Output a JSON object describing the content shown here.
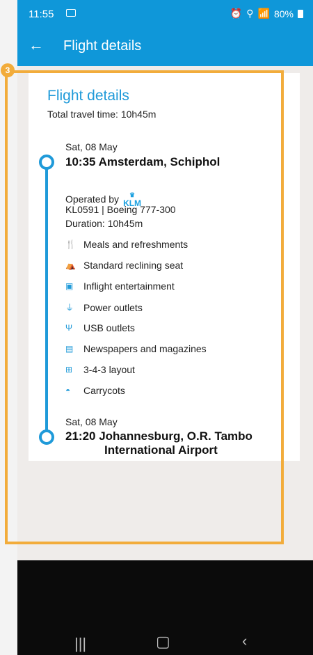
{
  "status": {
    "time": "11:55",
    "battery": "80%"
  },
  "appbar": {
    "title": "Flight details",
    "back_icon": "arrow-left-icon"
  },
  "badge": "3",
  "card": {
    "title": "Flight details",
    "total_time": "Total travel time: 10h45m",
    "departure": {
      "date": "Sat, 08 May",
      "time_place": "10:35  Amsterdam, Schiphol"
    },
    "operated_by": "Operated by",
    "airline_logo_text": "KLM",
    "flight": "KL0591 | Boeing 777-300",
    "duration": "Duration: 10h45m",
    "amenities": [
      {
        "icon": "meal-icon",
        "label": "Meals and refreshments"
      },
      {
        "icon": "seat-icon",
        "label": "Standard reclining seat"
      },
      {
        "icon": "tv-icon",
        "label": "Inflight entertainment"
      },
      {
        "icon": "plug-icon",
        "label": "Power outlets"
      },
      {
        "icon": "usb-icon",
        "label": "USB outlets"
      },
      {
        "icon": "newspaper-icon",
        "label": "Newspapers and magazines"
      },
      {
        "icon": "seat-layout-icon",
        "label": "3-4-3 layout"
      },
      {
        "icon": "carrycot-icon",
        "label": "Carrycots"
      }
    ],
    "arrival": {
      "date": "Sat, 08 May",
      "time_place_line1": "21:20  Johannesburg, O.R. Tambo",
      "time_place_line2": "International Airport"
    }
  },
  "colors": {
    "primary": "#0f97d9",
    "accent": "#f2ac3b"
  }
}
